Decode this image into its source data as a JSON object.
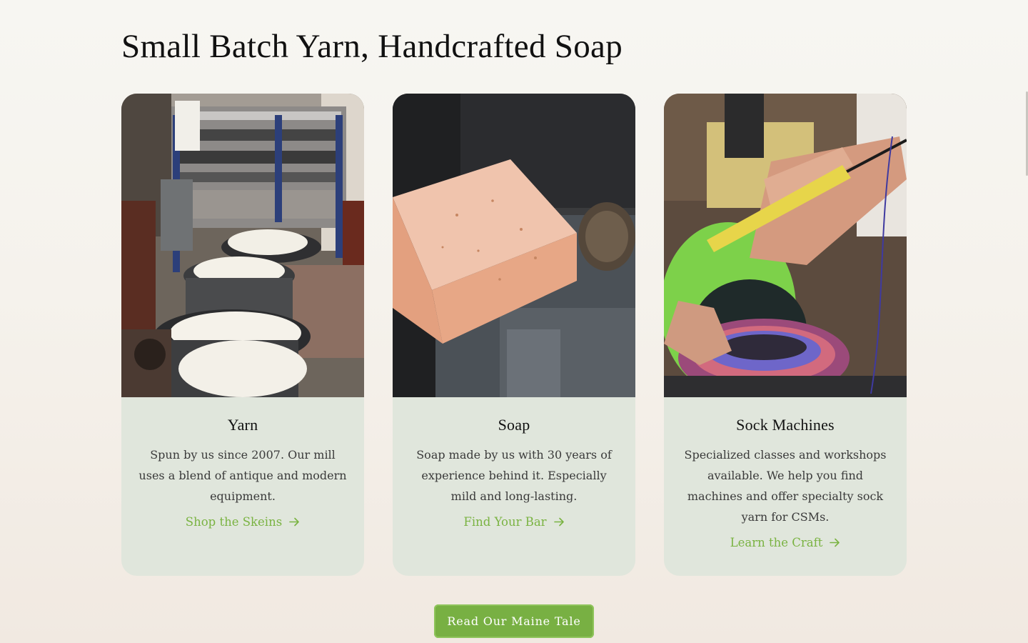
{
  "section": {
    "title": "Small Batch Yarn, Handcrafted Soap"
  },
  "cards": [
    {
      "title": "Yarn",
      "description": "Spun by us since 2007. Our mill uses a blend of antique and modern equipment.",
      "link_label": "Shop the Skeins",
      "image": "yarn-mill-photo"
    },
    {
      "title": "Soap",
      "description": "Soap made by us with 30 years of experience behind it. Especially mild and long-lasting.",
      "link_label": "Find Your Bar",
      "image": "soap-bar-photo"
    },
    {
      "title": "Sock Machines",
      "description": "Specialized classes and workshops available. We help you find machines and offer specialty sock yarn for CSMs.",
      "link_label": "Learn the Craft",
      "image": "sock-machine-photo"
    }
  ],
  "cta": {
    "label": "Read Our Maine Tale"
  },
  "icons": {
    "link_arrow": "arrow-right-icon"
  },
  "colors": {
    "accent": "#78b043",
    "card_bg": "#e0e6dc"
  }
}
